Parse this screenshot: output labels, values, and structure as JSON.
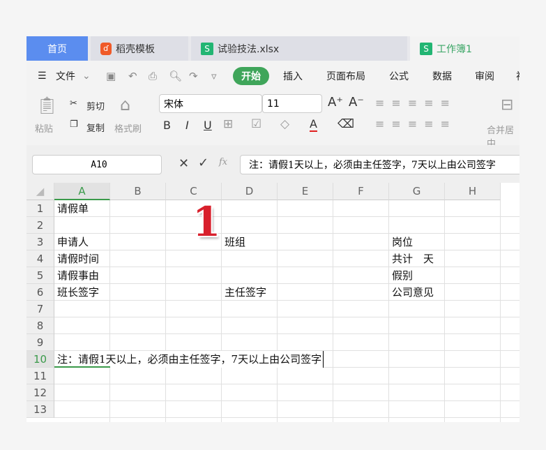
{
  "tabs": [
    {
      "label": "首页"
    },
    {
      "label": "稻壳模板"
    },
    {
      "label": "试验技法.xlsx"
    },
    {
      "label": "工作簿1"
    }
  ],
  "menu": {
    "file": "文件",
    "items": [
      "开始",
      "插入",
      "页面布局",
      "公式",
      "数据",
      "审阅",
      "视"
    ]
  },
  "toolbar": {
    "paste": "粘贴",
    "cut": "剪切",
    "copy": "复制",
    "format_painter": "格式刷",
    "font": "宋体",
    "size": "11",
    "bold": "B",
    "italic": "I",
    "underline": "U",
    "font_color": "A",
    "merge": "合并居中"
  },
  "formula_bar": {
    "name_box": "A10",
    "fx": "fx",
    "value": "注：请假1天以上，必须由主任签字，7天以上由公司签字"
  },
  "columns": [
    "A",
    "B",
    "C",
    "D",
    "E",
    "F",
    "G",
    "H"
  ],
  "rows": [
    "1",
    "2",
    "3",
    "4",
    "5",
    "6",
    "7",
    "8",
    "9",
    "10",
    "11",
    "12",
    "13"
  ],
  "cells": {
    "A1": "请假单",
    "A3": "申请人",
    "D3": "班组",
    "G3": "岗位",
    "A4": "请假时间",
    "G4": "共计　天",
    "A5": "请假事由",
    "G5": "假别",
    "A6": "班长签字",
    "D6": "主任签字",
    "G6": "公司意见",
    "A10": "注：请假1天以上，必须由主任签字，7天以上由公司签字"
  },
  "annotation": "1",
  "colors": {
    "accent": "#3fa55a",
    "home_tab": "#5b8def"
  }
}
